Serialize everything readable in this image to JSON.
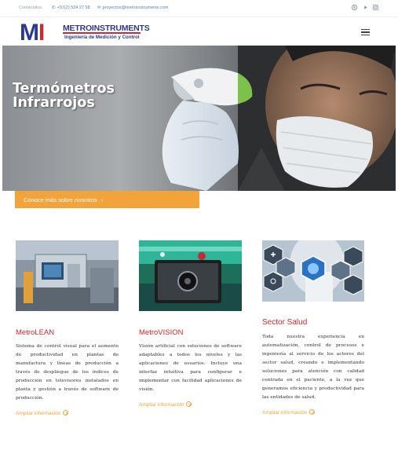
{
  "topbar": {
    "contact_label": "Contáctalos:",
    "phone": "+57(2) 524 27 58",
    "email": "proyectos@metroinstruments.com",
    "social_icons": [
      "skype-icon",
      "youtube-icon",
      "instagram-icon"
    ]
  },
  "header": {
    "logo_letters": "MI",
    "logo_brand": "METROINSTRUMENTS",
    "logo_tagline": "Ingeniería de Medición y Control",
    "menu_icon": "hamburger-menu-icon"
  },
  "hero": {
    "title_line1": "Termómetros",
    "title_line2": "Infrarrojos"
  },
  "cta": {
    "label": "Conoce más sobre nosotros",
    "arrow": "›"
  },
  "cards": [
    {
      "title": "MetroLEAN",
      "text": "Sistema de control visual para el aumento de productividad en plantas de manufactura y líneas de producción a través de despliegue de los índices de producción en televisores instalados en planta y gestión a través de software de producción.",
      "link": "Ampliar información"
    },
    {
      "title": "MetroVISION",
      "text": "Visión artificial con soluciones de software adaptables a todos los niveles y las aplicaciones de usuarios. Incluye una interfaz intuitiva para configurar e implementar con facilidad aplicaciones de visión.",
      "link": "Ampliar información"
    },
    {
      "title": "Sector Salud",
      "text": "Toda nuestra experiencia en automatización, control de procesos e ingeniería al servicio de los actores del sector salud, creando e implementando soluciones para atención con calidad centrada en el paciente, a la vez que generamos eficiencia y productividad para las entidades de salud.",
      "link": "Ampliar información"
    }
  ],
  "colors": {
    "accent_orange": "#f2a33a",
    "title_red": "#d6262c",
    "brand_blue": "#2b3a8f",
    "topbar_link": "#5b7fb3"
  }
}
